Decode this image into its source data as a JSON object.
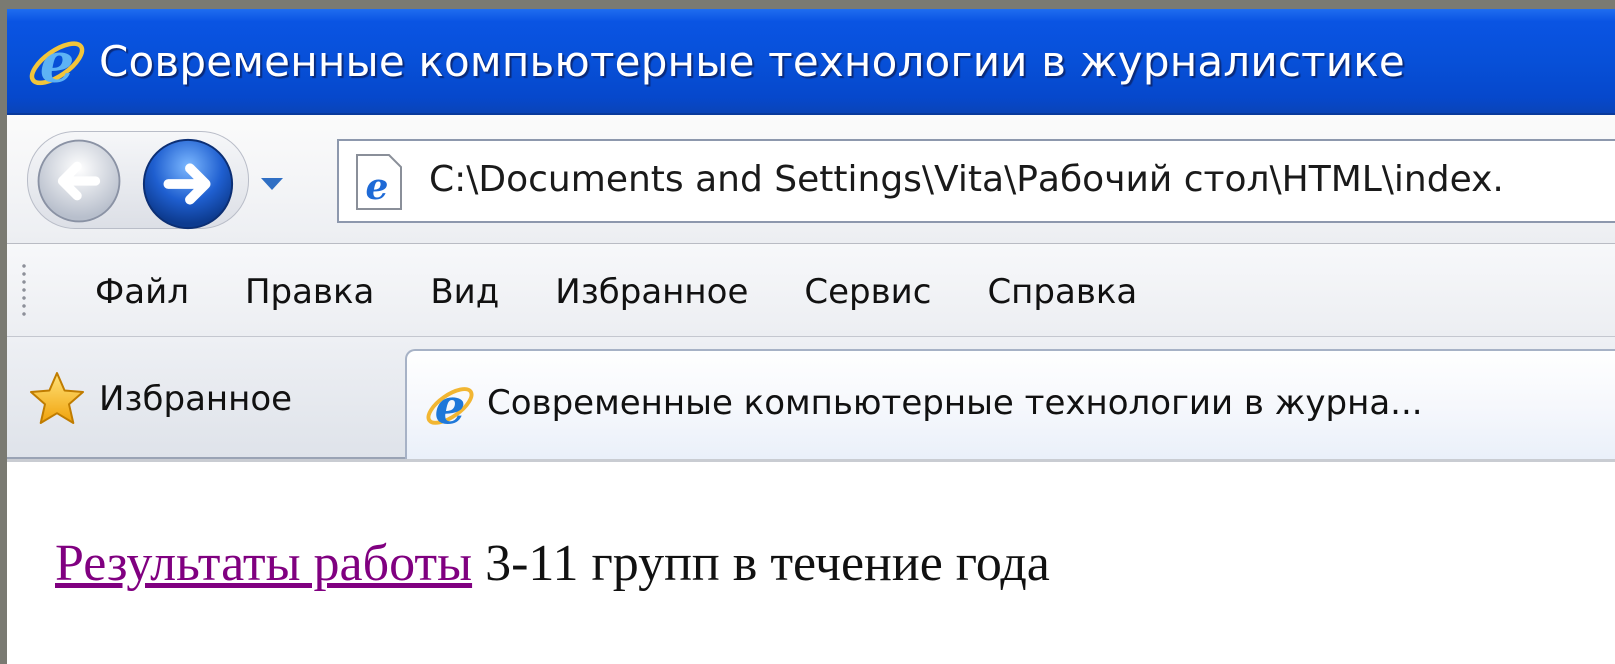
{
  "window": {
    "title": "Современные компьютерные технологии в журналистике"
  },
  "navigation": {
    "address": "C:\\Documents and Settings\\Vita\\Рабочий стол\\HTML\\index."
  },
  "menu": {
    "items": [
      "Файл",
      "Правка",
      "Вид",
      "Избранное",
      "Сервис",
      "Справка"
    ]
  },
  "favorites": {
    "label": "Избранное"
  },
  "tab": {
    "title": "Современные компьютерные технологии в журна..."
  },
  "content": {
    "link_text": "Результаты работы",
    "rest_text": " 3-11 групп в течение года"
  },
  "colors": {
    "titlebar": "#0750d8",
    "visited_link": "#800080"
  },
  "icons": {
    "title": "ie-logo-icon",
    "back": "back-arrow-icon",
    "forward": "forward-arrow-icon",
    "favorites": "star-icon"
  }
}
